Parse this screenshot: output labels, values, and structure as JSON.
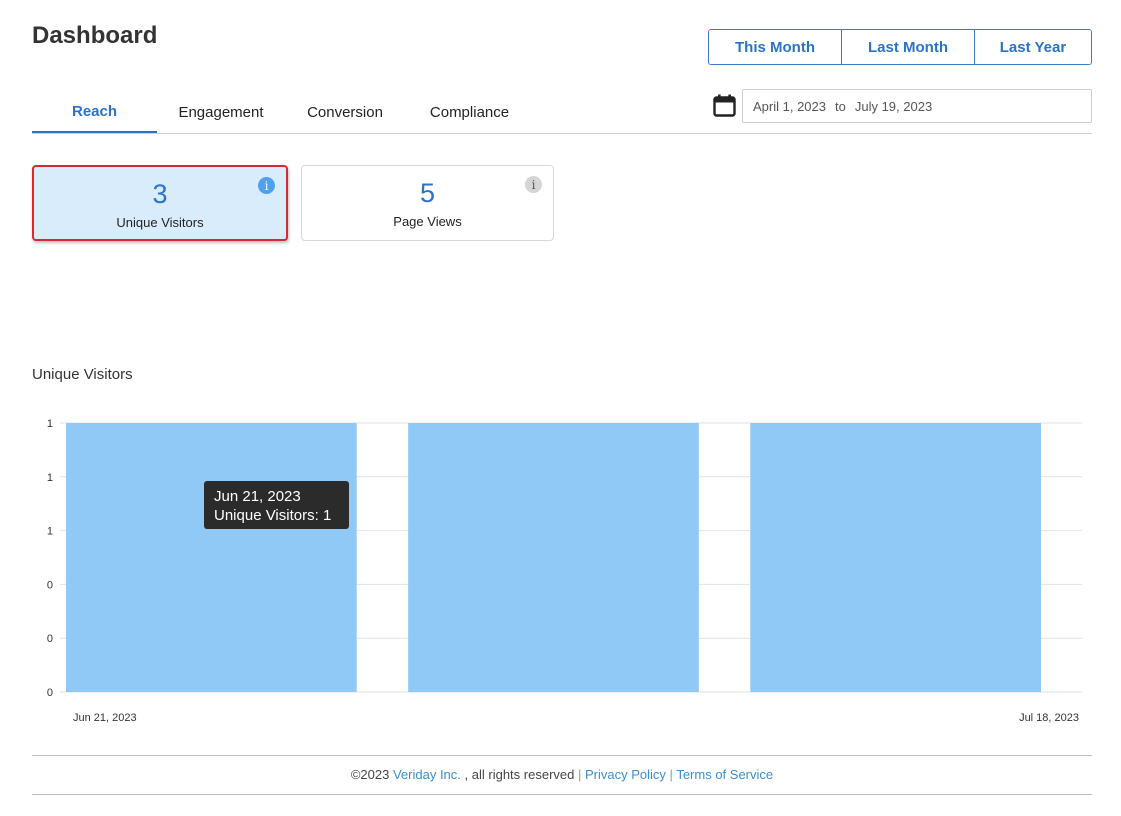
{
  "page": {
    "title": "Dashboard"
  },
  "range_buttons": [
    "This Month",
    "Last Month",
    "Last Year"
  ],
  "tabs": [
    "Reach",
    "Engagement",
    "Conversion",
    "Compliance"
  ],
  "active_tab": "Reach",
  "date_range": {
    "from": "April 1, 2023",
    "to_label": "to",
    "to": "July 19, 2023"
  },
  "cards": [
    {
      "value": "3",
      "label": "Unique Visitors",
      "selected": true
    },
    {
      "value": "5",
      "label": "Page Views",
      "selected": false
    }
  ],
  "info_glyph": "i",
  "chart_data": {
    "type": "bar",
    "title": "Unique Visitors",
    "categories": [
      "Jun 21, 2023",
      "",
      "Jul 18, 2023"
    ],
    "values": [
      1,
      1,
      1
    ],
    "ytick_labels": [
      "1",
      "1",
      "1",
      "0",
      "0",
      "0"
    ],
    "x_endpoint_labels": [
      "Jun 21, 2023",
      "Jul 18, 2023"
    ],
    "ylim": [
      0,
      1
    ],
    "grid": true,
    "bar_color": "#90c8f6"
  },
  "tooltip": {
    "line1": "Jun 21, 2023",
    "line2": "Unique Visitors: 1"
  },
  "footer": {
    "copyright": "©2023",
    "company": "Veriday Inc.",
    "rights": ", all rights reserved",
    "sep": "|",
    "privacy": "Privacy Policy",
    "terms": "Terms of Service"
  },
  "colors": {
    "accent": "#2a73c7",
    "selected_border": "#d9282f",
    "selected_bg": "#d8ecfc"
  },
  "icons": {
    "calendar": "calendar-icon",
    "info": "info-icon"
  }
}
